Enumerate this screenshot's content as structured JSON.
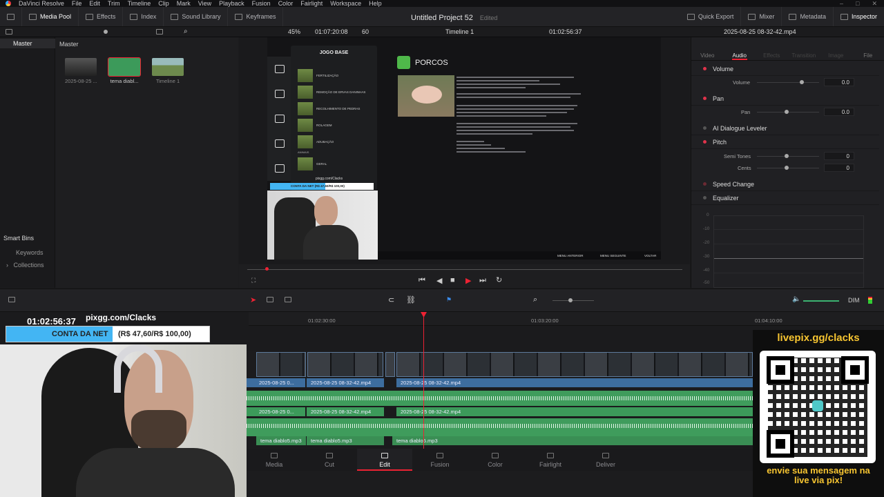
{
  "menu": {
    "app": "DaVinci Resolve",
    "items": [
      "File",
      "Edit",
      "Trim",
      "Timeline",
      "Clip",
      "Mark",
      "View",
      "Playback",
      "Fusion",
      "Color",
      "Fairlight",
      "Workspace",
      "Help"
    ]
  },
  "toolbar": {
    "media_pool": "Media Pool",
    "effects": "Effects",
    "index": "Index",
    "sound_library": "Sound Library",
    "keyframes": "Keyframes",
    "quick_export": "Quick Export",
    "mixer": "Mixer",
    "metadata": "Metadata",
    "inspector": "Inspector"
  },
  "project": {
    "name": "Untitled Project 52",
    "status": "Edited"
  },
  "viewerbar": {
    "zoom": "45%",
    "source_tc": "01:07:20:08",
    "fps": "60",
    "timeline_name": "Timeline 1",
    "record_tc": "01:02:56:37",
    "clip_name": "2025-08-25 08-32-42.mp4"
  },
  "bins": {
    "master": "Master",
    "master_header": "Master",
    "smart_bins": "Smart Bins",
    "keywords": "Keywords",
    "collections": "Collections"
  },
  "media": [
    {
      "label": "2025-08-25 ...",
      "color": "#3a3a3c"
    },
    {
      "label": "tema diabl...",
      "color": "#3c9a5a"
    },
    {
      "label": "Timeline 1",
      "color": "#6d8a4d"
    }
  ],
  "game": {
    "panel_title": "JOGO BASE",
    "rows": [
      "FERTILIZAÇÃO",
      "REMOÇÃO DE ERVAS DANINHAS",
      "RECOLHIMENTO DE PEDRAS",
      "ROLAGEM",
      "ADUBAÇÃO",
      "ANIMAIS",
      "GERAL"
    ],
    "streamer_url": "pixgg.com/Clacks",
    "banner": "CONTA DA NET (R$ 47,60/R$ 100,00)",
    "article_title": "PORCOS",
    "footer": [
      "MENU ANTERIOR",
      "MENU SEGUINTE",
      "VOLTAR"
    ]
  },
  "inspector": {
    "tabs": [
      "Video",
      "Audio",
      "Effects",
      "Transition",
      "Image",
      "File"
    ],
    "volume": "Volume",
    "volume_sub": "Volume",
    "volume_val": "0.0",
    "pan": "Pan",
    "pan_sub": "Pan",
    "pan_val": "0.0",
    "ai": "AI Dialogue Leveler",
    "pitch": "Pitch",
    "semitones": "Semi Tones",
    "semitones_val": "0",
    "cents": "Cents",
    "cents_val": "0",
    "speed": "Speed Change",
    "eq": "Equalizer",
    "eq_labels": [
      "0",
      "-10",
      "-20",
      "-30",
      "-40",
      "-50"
    ]
  },
  "timeline": {
    "overlay_tc": "01:02:56:37",
    "overlay_url": "pixgg.com/Clacks",
    "overlay_banner_left": "CONTA DA NET",
    "overlay_banner_right": "(R$ 47,60/R$ 100,00)",
    "ticks": [
      "01:02:30:00",
      "01:03:20:00",
      "01:04:10:00"
    ],
    "clips": [
      "2025-08-25 0...",
      "2025-08-25 08-32-42.mp4",
      "2025-08-25 08-32-42.mp4"
    ],
    "audio": [
      "tema diablo5.mp3",
      "tema diablo5.mp3",
      "tema diablo5.mp3"
    ],
    "dim": "DIM"
  },
  "pages": [
    "Media",
    "Cut",
    "Edit",
    "Fusion",
    "Color",
    "Fairlight",
    "Deliver"
  ],
  "livepix": {
    "top": "livepix.gg/clacks",
    "bottom1": "envie sua mensagem na",
    "bottom2": "live via pix!"
  }
}
